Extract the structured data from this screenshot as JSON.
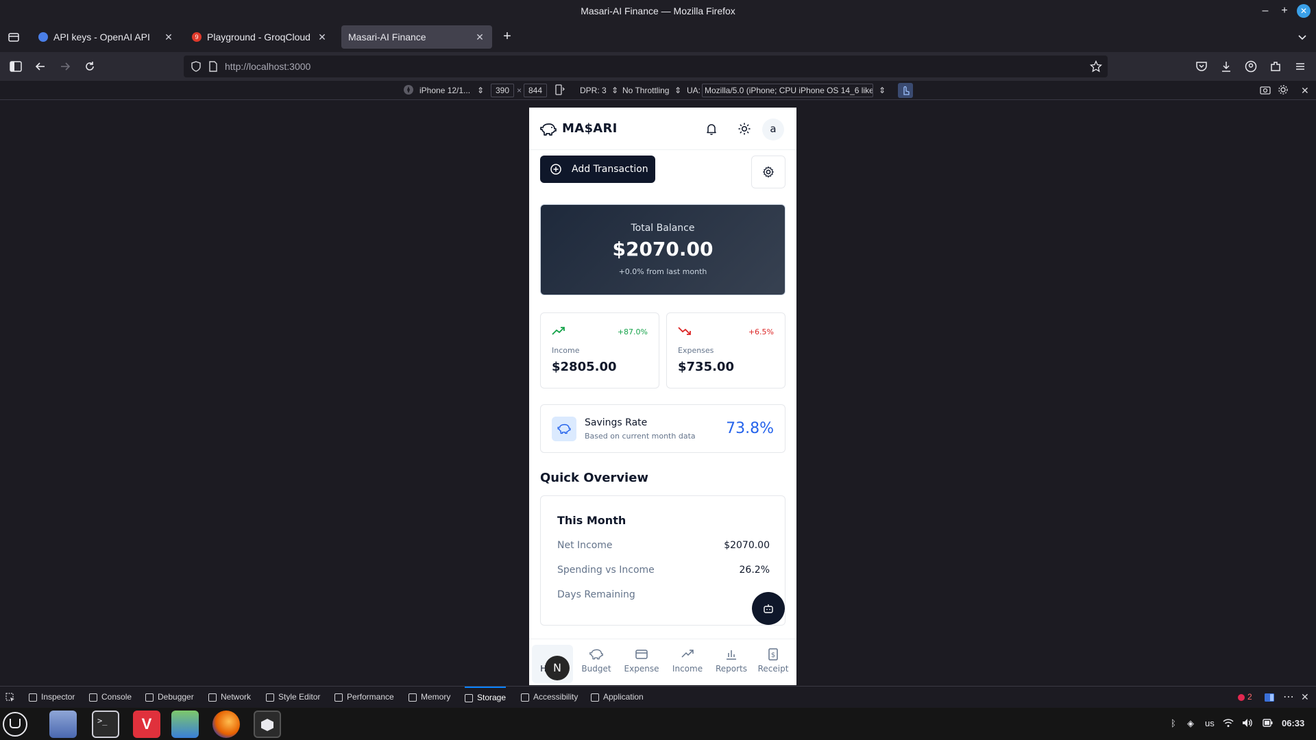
{
  "window": {
    "title": "Masari-AI Finance — Mozilla Firefox"
  },
  "tabs": [
    {
      "label": "API keys - OpenAI API",
      "favicon_color": "#4a7fe8"
    },
    {
      "label": "Playground - GroqCloud",
      "favicon_color": "#e0392b",
      "badge": "9"
    },
    {
      "label": "Masari-AI Finance",
      "active": true
    }
  ],
  "navbar": {
    "url": "http://localhost:3000"
  },
  "rdm": {
    "device": "iPhone 12/1...",
    "width": "390",
    "times": "×",
    "height": "844",
    "dpr": "DPR: 3",
    "throttling": "No Throttling",
    "ua_label": "UA:",
    "ua_value": "Mozilla/5.0 (iPhone; CPU iPhone OS 14_6 like"
  },
  "app": {
    "brand": "MA$ARI",
    "avatar_letter": "a",
    "add_transaction_label": "Add Transaction",
    "balance": {
      "label": "Total Balance",
      "value": "$2070.00",
      "change": "+0.0% from last month"
    },
    "income": {
      "label": "Income",
      "value": "$2805.00",
      "pct": "+87.0%"
    },
    "expenses": {
      "label": "Expenses",
      "value": "$735.00",
      "pct": "+6.5%"
    },
    "savings": {
      "title": "Savings Rate",
      "subtitle": "Based on current month data",
      "value": "73.8%"
    },
    "overview": {
      "title": "Quick Overview",
      "card_title": "This Month",
      "rows": [
        {
          "key": "Net Income",
          "value": "$2070.00"
        },
        {
          "key": "Spending vs Income",
          "value": "26.2%"
        },
        {
          "key": "Days Remaining",
          "value": ""
        }
      ]
    },
    "bottom_nav": [
      {
        "label": "Home",
        "icon": "home-icon",
        "active": true
      },
      {
        "label": "Budget",
        "icon": "piggy-bank-icon"
      },
      {
        "label": "Expense",
        "icon": "credit-card-icon"
      },
      {
        "label": "Income",
        "icon": "trending-up-icon"
      },
      {
        "label": "Reports",
        "icon": "bar-chart-icon"
      },
      {
        "label": "Receipt",
        "icon": "receipt-icon"
      }
    ],
    "home_badge": "N",
    "colors": {
      "primary": "#0f172a",
      "income_green": "#16a34a",
      "expense_red": "#dc2626",
      "savings_blue": "#2563eb"
    }
  },
  "devtools": {
    "tabs": [
      "Inspector",
      "Console",
      "Debugger",
      "Network",
      "Style Editor",
      "Performance",
      "Memory",
      "Storage",
      "Accessibility",
      "Application"
    ],
    "active_tab": "Storage",
    "error_count": "2"
  },
  "taskbar": {
    "layout": "us",
    "time": "06:33"
  }
}
